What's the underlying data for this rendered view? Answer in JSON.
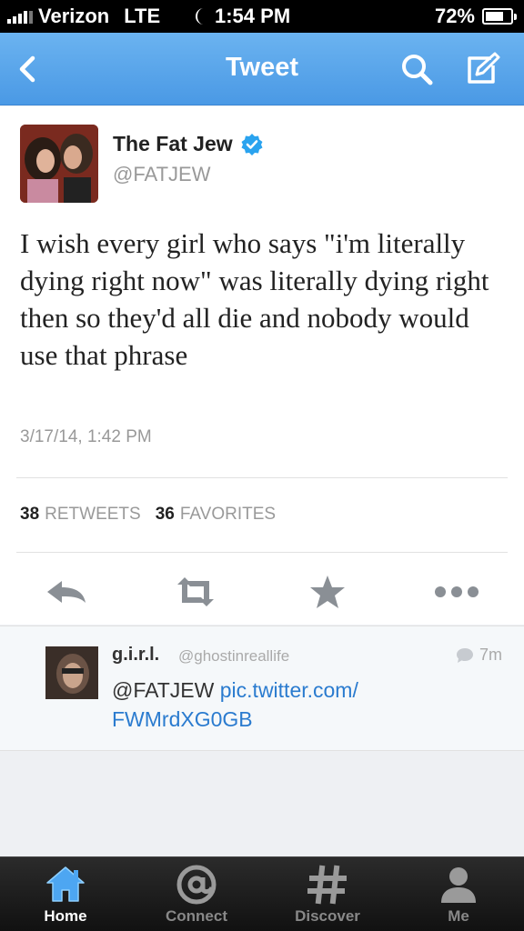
{
  "status_bar": {
    "carrier": "Verizon",
    "network": "LTE",
    "time": "1:54 PM",
    "battery": "72%",
    "battery_level": 0.72
  },
  "nav": {
    "title": "Tweet",
    "accent": "#55acee",
    "icons": [
      "chevron-left-icon",
      "search-icon",
      "compose-icon"
    ]
  },
  "tweet": {
    "name": "The Fat Jew",
    "handle": "@FATJEW",
    "text": "I wish every girl who says \"i'm literally dying right now\" was literally dying right then so they'd all die and nobody would use that phrase",
    "timestamp": "3/17/14, 1:42 PM",
    "retweets_count": "38",
    "retweets_label": "RETWEETS",
    "favorites_count": "36",
    "favorites_label": "FAVORITES",
    "actions": [
      "reply-icon",
      "retweet-icon",
      "favorite-icon",
      "more-icon"
    ]
  },
  "reply": {
    "name": "g.i.r.l.",
    "handle": "@ghostinreallife",
    "time": "7m",
    "mention": "@FATJEW",
    "link": "pic.twitter.com/ FWMrdXG0GB"
  },
  "tabs": [
    {
      "label": "Home",
      "icon": "home-icon",
      "active": true
    },
    {
      "label": "Connect",
      "icon": "at-icon",
      "active": false
    },
    {
      "label": "Discover",
      "icon": "hashtag-icon",
      "active": false
    },
    {
      "label": "Me",
      "icon": "person-icon",
      "active": false
    }
  ]
}
